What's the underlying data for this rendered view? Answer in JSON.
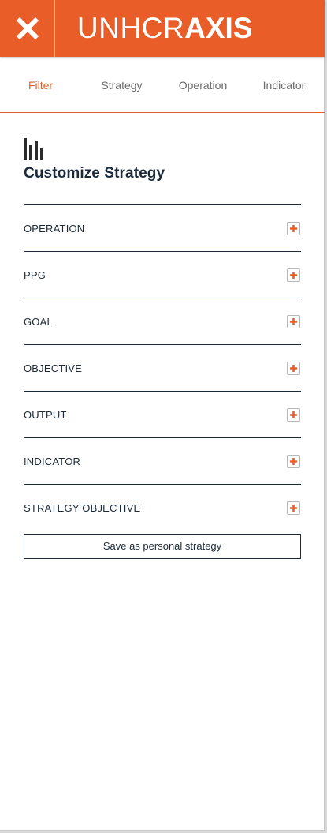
{
  "header": {
    "brand_light": "UNHCR",
    "brand_bold": "AXIS",
    "accent_color": "#e95e28",
    "close_icon": "close-icon"
  },
  "tabs": [
    {
      "label": "Filter",
      "active": true
    },
    {
      "label": "Strategy",
      "active": false
    },
    {
      "label": "Operation",
      "active": false
    },
    {
      "label": "Indicator",
      "active": false
    }
  ],
  "main": {
    "icon": "bar-chart-icon",
    "title": "Customize Strategy",
    "sections": [
      {
        "label": "OPERATION"
      },
      {
        "label": "PPG"
      },
      {
        "label": "GOAL"
      },
      {
        "label": "OBJECTIVE"
      },
      {
        "label": "OUTPUT"
      },
      {
        "label": "INDICATOR"
      },
      {
        "label": "STRATEGY OBJECTIVE"
      }
    ],
    "expand_icon": "plus-icon",
    "save_label": "Save as personal strategy"
  }
}
